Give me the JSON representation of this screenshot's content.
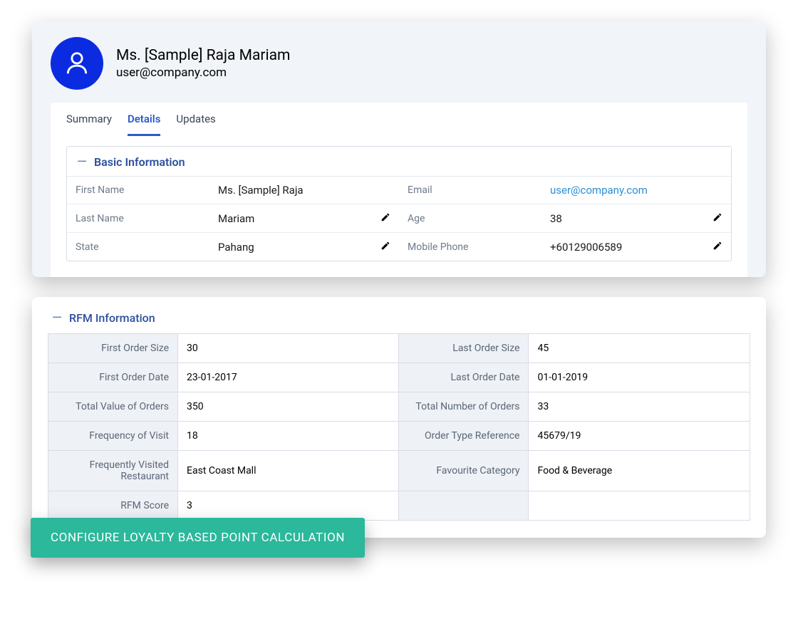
{
  "profile": {
    "name": "Ms. [Sample] Raja Mariam",
    "email": "user@company.com"
  },
  "tabs": [
    "Summary",
    "Details",
    "Updates"
  ],
  "basic": {
    "title": "Basic Information",
    "rows": [
      {
        "l1": "First Name",
        "v1": "Ms. [Sample] Raja",
        "e1": false,
        "l2": "Email",
        "v2": "user@company.com",
        "e2": false,
        "link2": true
      },
      {
        "l1": "Last Name",
        "v1": "Mariam",
        "e1": true,
        "l2": "Age",
        "v2": "38",
        "e2": true
      },
      {
        "l1": "State",
        "v1": "Pahang",
        "e1": true,
        "l2": "Mobile Phone",
        "v2": "+60129006589",
        "e2": true
      }
    ]
  },
  "rfm": {
    "title": "RFM Information",
    "rows": [
      {
        "l1": "First Order Size",
        "v1": "30",
        "l2": "Last Order Size",
        "v2": "45"
      },
      {
        "l1": "First Order Date",
        "v1": "23-01-2017",
        "l2": "Last Order Date",
        "v2": "01-01-2019"
      },
      {
        "l1": "Total Value of Orders",
        "v1": "350",
        "l2": "Total Number of Orders",
        "v2": "33"
      },
      {
        "l1": "Frequency of Visit",
        "v1": "18",
        "l2": "Order Type Reference",
        "v2": "45679/19"
      },
      {
        "l1": "Frequently Visited Restaurant",
        "v1": "East Coast Mall",
        "l2": "Favourite Category",
        "v2": "Food & Beverage"
      },
      {
        "l1": "RFM Score",
        "v1": "3",
        "l2": "",
        "v2": ""
      }
    ]
  },
  "cta": "CONFIGURE LOYALTY BASED POINT CALCULATION"
}
